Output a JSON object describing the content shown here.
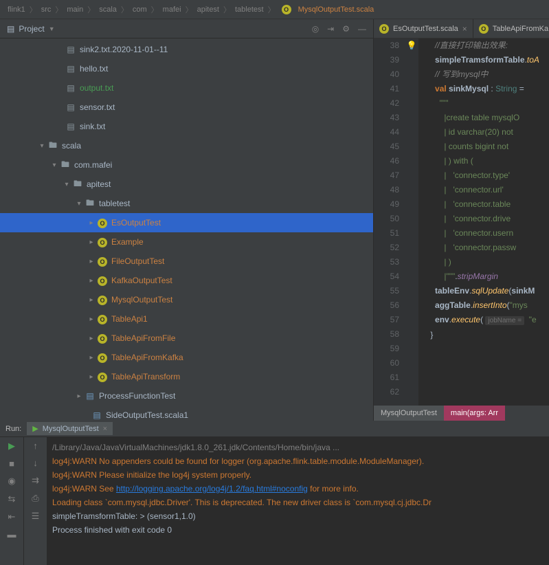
{
  "breadcrumbs": [
    "flink1",
    "src",
    "main",
    "scala",
    "com",
    "mafei",
    "apitest",
    "tabletest",
    "MysqlOutputTest.scala"
  ],
  "project": {
    "label": "Project",
    "tree": [
      {
        "indent": 80,
        "arrow": "",
        "icon": "file",
        "label": "sink2.txt.2020-11-01--11",
        "cls": ""
      },
      {
        "indent": 80,
        "arrow": "",
        "icon": "file",
        "label": "hello.txt",
        "cls": ""
      },
      {
        "indent": 80,
        "arrow": "",
        "icon": "file",
        "label": "output.txt",
        "cls": "green-text"
      },
      {
        "indent": 80,
        "arrow": "",
        "icon": "file",
        "label": "sensor.txt",
        "cls": ""
      },
      {
        "indent": 80,
        "arrow": "",
        "icon": "file",
        "label": "sink.txt",
        "cls": ""
      },
      {
        "indent": 54,
        "arrow": "▾",
        "icon": "folder",
        "label": "scala",
        "cls": ""
      },
      {
        "indent": 72,
        "arrow": "▾",
        "icon": "folder",
        "label": "com.mafei",
        "cls": ""
      },
      {
        "indent": 90,
        "arrow": "▾",
        "icon": "folder",
        "label": "apitest",
        "cls": ""
      },
      {
        "indent": 108,
        "arrow": "▾",
        "icon": "folder",
        "label": "tabletest",
        "cls": ""
      },
      {
        "indent": 126,
        "arrow": "▸",
        "icon": "obj",
        "label": "EsOutputTest",
        "cls": "orange-text",
        "selected": true
      },
      {
        "indent": 126,
        "arrow": "▸",
        "icon": "obj",
        "label": "Example",
        "cls": "orange-text"
      },
      {
        "indent": 126,
        "arrow": "▸",
        "icon": "obj",
        "label": "FileOutputTest",
        "cls": "orange-text"
      },
      {
        "indent": 126,
        "arrow": "▸",
        "icon": "obj",
        "label": "KafkaOutputTest",
        "cls": "orange-text"
      },
      {
        "indent": 126,
        "arrow": "▸",
        "icon": "obj",
        "label": "MysqlOutputTest",
        "cls": "orange-text"
      },
      {
        "indent": 126,
        "arrow": "▸",
        "icon": "obj",
        "label": "TableApi1",
        "cls": "orange-text"
      },
      {
        "indent": 126,
        "arrow": "▸",
        "icon": "obj",
        "label": "TableApiFromFile",
        "cls": "orange-text"
      },
      {
        "indent": 126,
        "arrow": "▸",
        "icon": "obj",
        "label": "TableApiFromKafka",
        "cls": "orange-text"
      },
      {
        "indent": 126,
        "arrow": "▸",
        "icon": "obj",
        "label": "TableApiTransform",
        "cls": "orange-text"
      },
      {
        "indent": 108,
        "arrow": "▸",
        "icon": "scala",
        "label": "ProcessFunctionTest",
        "cls": ""
      },
      {
        "indent": 118,
        "arrow": "",
        "icon": "scala",
        "label": "SideOutputTest.scala1",
        "cls": ""
      }
    ]
  },
  "editor": {
    "tabs": [
      {
        "label": "EsOutputTest.scala",
        "close": true
      },
      {
        "label": "TableApiFromKa",
        "close": false
      }
    ],
    "lines": [
      {
        "n": "38",
        "html": "      <span class='cm-comment'>//直接打印输出效果:</span>"
      },
      {
        "n": "39",
        "html": "      <span class='cm-def'>simpleTramsformTable</span>.<span class='cm-method'>toA</span>"
      },
      {
        "n": "40",
        "html": ""
      },
      {
        "n": "41",
        "html": ""
      },
      {
        "n": "42",
        "html": "      <span class='cm-comment'>// 写到mysql中</span>"
      },
      {
        "n": "43",
        "html": "      <span class='cm-keyword'>val</span> <span class='cm-def'>sinkMysql</span> : <span class='cm-type'>String</span> <span class='cm-paren'>=</span>"
      },
      {
        "n": "44",
        "html": "        <span class='cm-str'>\"\"\"</span>"
      },
      {
        "n": "45",
        "html": "          <span class='cm-str'>|create table mysqlO</span>"
      },
      {
        "n": "46",
        "html": "          <span class='cm-str'>| id varchar(20) not</span>"
      },
      {
        "n": "47",
        "html": "          <span class='cm-str'>| counts bigint not </span>"
      },
      {
        "n": "48",
        "html": "          <span class='cm-str'>| ) with (</span>"
      },
      {
        "n": "49",
        "html": "          <span class='cm-str'>|   'connector.type'</span>"
      },
      {
        "n": "50",
        "bulb": true,
        "html": "          <span class='cm-str'>|   'connector.url' </span>"
      },
      {
        "n": "51",
        "html": "          <span class='cm-str'>|   'connector.table</span>"
      },
      {
        "n": "52",
        "html": "          <span class='cm-str'>|   'connector.drive</span>"
      },
      {
        "n": "53",
        "html": "          <span class='cm-str'>|   'connector.usern</span>"
      },
      {
        "n": "54",
        "html": "          <span class='cm-str'>|   'connector.passw</span>"
      },
      {
        "n": "55",
        "html": "          <span class='cm-str'>| )</span>"
      },
      {
        "n": "56",
        "html": "          <span class='cm-str'>|\"\"\"</span>.<span class='cm-ident'>stripMargin</span>"
      },
      {
        "n": "57",
        "html": ""
      },
      {
        "n": "58",
        "html": "      <span class='cm-def'>tableEnv</span>.<span class='cm-method'>sqlUpdate</span>(<span class='cm-def'>sinkM</span>"
      },
      {
        "n": "59",
        "html": "      <span class='cm-def'>aggTable</span>.<span class='cm-method'>insertInto</span>(<span class='cm-str'>\"mys</span>"
      },
      {
        "n": "60",
        "html": ""
      },
      {
        "n": "61",
        "html": "      <span class='cm-def'>env</span>.<span class='cm-method'>execute</span>( <span class='cm-hint'>jobName =</span>  <span class='cm-str'>\"e</span>"
      },
      {
        "n": "62",
        "html": "    }"
      }
    ],
    "crumbs": [
      "MysqlOutputTest",
      "main(args: Arr"
    ]
  },
  "run": {
    "label": "Run:",
    "tab": "MysqlOutputTest",
    "lines": [
      {
        "cls": "con-gray",
        "text": "/Library/Java/JavaVirtualMachines/jdk1.8.0_261.jdk/Contents/Home/bin/java ..."
      },
      {
        "cls": "con-warn",
        "text": "log4j:WARN No appenders could be found for logger (org.apache.flink.table.module.ModuleManager)."
      },
      {
        "cls": "con-warn",
        "text": "log4j:WARN Please initialize the log4j system properly."
      },
      {
        "cls": "",
        "html": "<span class='con-warn'>log4j:WARN See </span><span class='con-link'>http://logging.apache.org/log4j/1.2/faq.html#noconfig</span><span class='con-warn'> for more info.</span>"
      },
      {
        "cls": "",
        "html": "<span class='con-warn'>Loading class `com.mysql.jdbc.Driver'. This is deprecated. The new driver class is `com.mysql.cj.jdbc.Dr</span>"
      },
      {
        "cls": "",
        "text": "simpleTramsformTable: > (sensor1,1.0)"
      },
      {
        "cls": "",
        "text": ""
      },
      {
        "cls": "",
        "text": "Process finished with exit code 0"
      }
    ]
  }
}
